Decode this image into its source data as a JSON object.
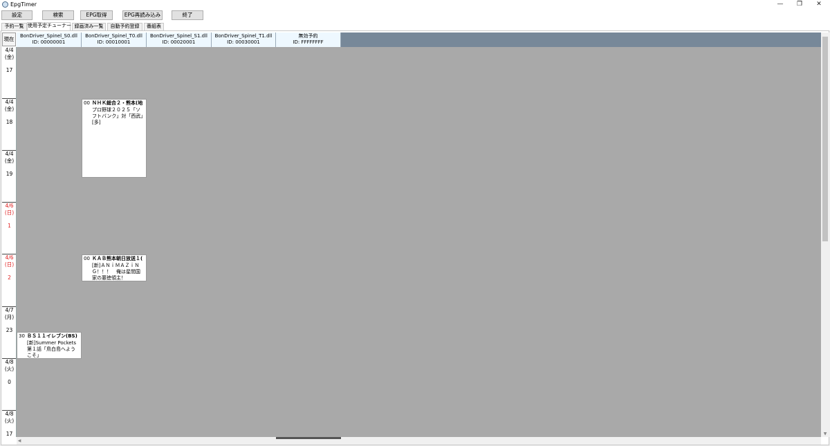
{
  "window": {
    "title": "EpgTimer",
    "controls": {
      "minimize": "—",
      "restore": "❐",
      "close": "✕"
    }
  },
  "toolbar": {
    "settings": "設定",
    "search": "検索",
    "epg_get": "EPG取得",
    "epg_reload": "EPG再読み込み",
    "exit": "終了"
  },
  "tabs": [
    "予約一覧",
    "使用予定チューナー",
    "録画済み一覧",
    "自動予約登録",
    "番組表"
  ],
  "now_button": "現在",
  "tuners": [
    {
      "name": "BonDriver_Spinel_S0.dll",
      "id": "ID: 00000001"
    },
    {
      "name": "BonDriver_Spinel_T0.dll",
      "id": "ID: 00010001"
    },
    {
      "name": "BonDriver_Spinel_S1.dll",
      "id": "ID: 00020001"
    },
    {
      "name": "BonDriver_Spinel_T1.dll",
      "id": "ID: 00030001"
    },
    {
      "name": "無効予約",
      "id": "ID: FFFFFFFF"
    }
  ],
  "time_cells": [
    {
      "date": "4/4",
      "dow": "(金)",
      "hour": "17",
      "sunday": false
    },
    {
      "date": "4/4",
      "dow": "(金)",
      "hour": "18",
      "sunday": false
    },
    {
      "date": "4/4",
      "dow": "(金)",
      "hour": "19",
      "sunday": false
    },
    {
      "date": "4/6",
      "dow": "(日)",
      "hour": "1",
      "sunday": true
    },
    {
      "date": "4/6",
      "dow": "(日)",
      "hour": "2",
      "sunday": true
    },
    {
      "date": "4/7",
      "dow": "(月)",
      "hour": "23",
      "sunday": false
    },
    {
      "date": "4/8",
      "dow": "(火)",
      "hour": "0",
      "sunday": false
    },
    {
      "date": "4/8",
      "dow": "(火)",
      "hour": "17",
      "sunday": false
    }
  ],
  "programs": [
    {
      "minute": "00",
      "service": "ＮＨＫ総合２・熊本(地",
      "title": "プロ野球２０２５「ソフトバンク」対「西武」[多]"
    },
    {
      "minute": "00",
      "service": "ＫＡＢ熊本朝日放送１(",
      "title": "[新]ＡＮｉＭＡＺｉＮＧ！！！　俺は星間国家の悪徳領主！"
    },
    {
      "minute": "30",
      "service": "ＢＳ１１イレブン(BS)",
      "title": "[新]Summer Pockets 第１話「鳥白島へようこそ」"
    }
  ],
  "colors": {
    "grid_background": "#a9a9a9",
    "header_strip": "#778899",
    "tuner_header": "#eef8ff",
    "sunday_text": "#e02020"
  }
}
